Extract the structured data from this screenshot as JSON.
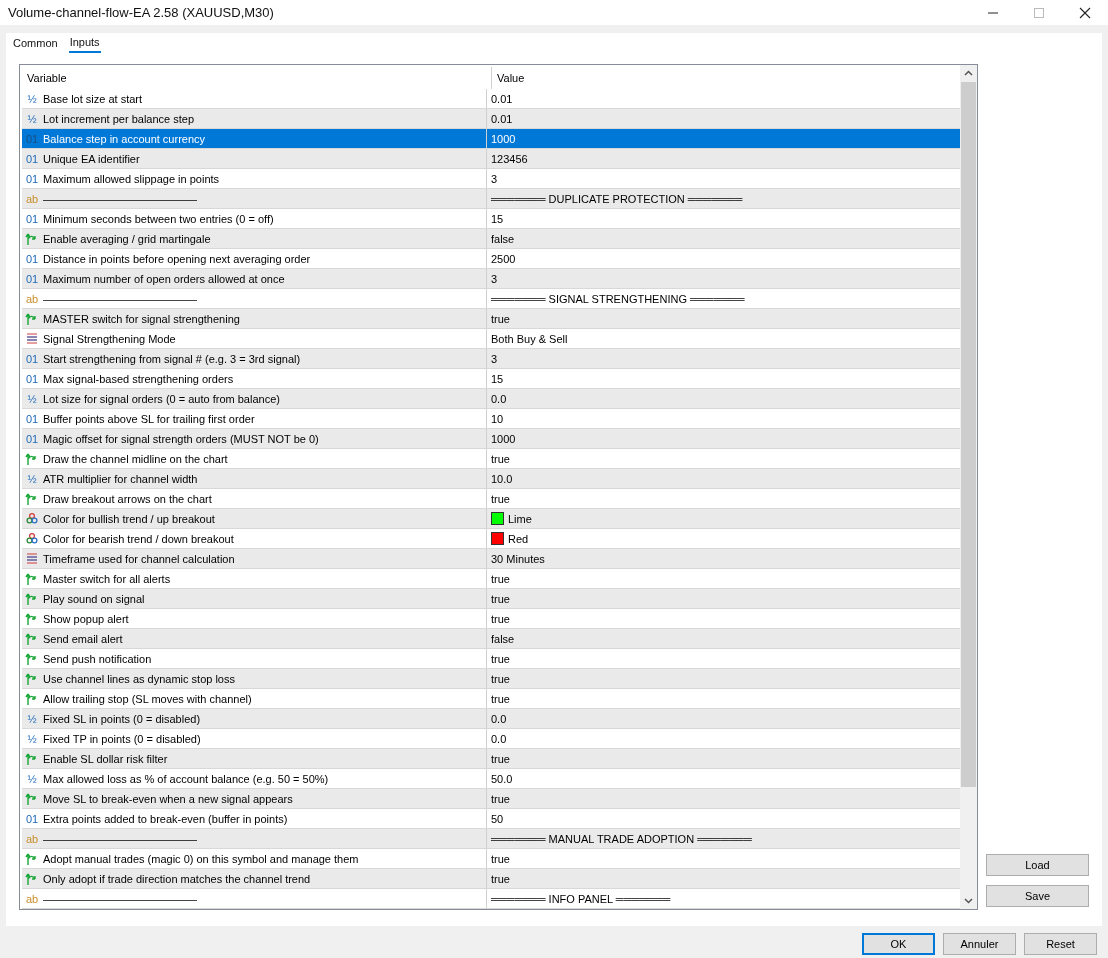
{
  "window": {
    "title": "Volume-channel-flow-EA 2.58 (XAUUSD,M30)"
  },
  "tabs": [
    {
      "label": "Common",
      "selected": false
    },
    {
      "label": "Inputs",
      "selected": true
    }
  ],
  "table": {
    "columns": [
      "Variable",
      "Value"
    ],
    "rows": [
      {
        "kind": "double",
        "icon": "½",
        "variable": "Base lot size at start",
        "value": "0.01",
        "selected": false
      },
      {
        "kind": "double",
        "icon": "½",
        "variable": "Lot increment per balance step",
        "value": "0.01",
        "selected": false
      },
      {
        "kind": "int",
        "icon": "01",
        "variable": "Balance step in account currency",
        "value": "1000",
        "selected": true
      },
      {
        "kind": "int",
        "icon": "01",
        "variable": "Unique EA identifier",
        "value": "123456",
        "selected": false
      },
      {
        "kind": "int",
        "icon": "01",
        "variable": "Maximum allowed slippage in points",
        "value": "3",
        "selected": false
      },
      {
        "kind": "string",
        "icon": "ab",
        "variable": "——————————————",
        "value": "═══════ DUPLICATE PROTECTION ═══════",
        "selected": false
      },
      {
        "kind": "int",
        "icon": "01",
        "variable": "Minimum seconds between two entries (0 = off)",
        "value": "15",
        "selected": false
      },
      {
        "kind": "bool",
        "variable": "Enable averaging / grid martingale",
        "value": "false",
        "selected": false
      },
      {
        "kind": "int",
        "icon": "01",
        "variable": "Distance in points before opening next averaging order",
        "value": "2500",
        "selected": false
      },
      {
        "kind": "int",
        "icon": "01",
        "variable": "Maximum number of open orders allowed at once",
        "value": "3",
        "selected": false
      },
      {
        "kind": "string",
        "icon": "ab",
        "variable": "——————————————",
        "value": "═══════ SIGNAL STRENGTHENING ═══════",
        "selected": false
      },
      {
        "kind": "bool",
        "variable": "MASTER switch for signal strengthening",
        "value": "true",
        "selected": false
      },
      {
        "kind": "enum",
        "variable": "Signal Strengthening Mode",
        "value": "Both Buy & Sell",
        "selected": false
      },
      {
        "kind": "int",
        "icon": "01",
        "variable": "Start strengthening from signal # (e.g. 3 = 3rd signal)",
        "value": "3",
        "selected": false
      },
      {
        "kind": "int",
        "icon": "01",
        "variable": "Max signal-based strengthening orders",
        "value": "15",
        "selected": false
      },
      {
        "kind": "double",
        "icon": "½",
        "variable": "Lot size for signal orders (0 = auto from balance)",
        "value": "0.0",
        "selected": false
      },
      {
        "kind": "int",
        "icon": "01",
        "variable": "Buffer points above SL for trailing first order",
        "value": "10",
        "selected": false
      },
      {
        "kind": "int",
        "icon": "01",
        "variable": "Magic offset for signal strength orders (MUST NOT be 0)",
        "value": "1000",
        "selected": false
      },
      {
        "kind": "bool",
        "variable": "Draw the channel midline on the chart",
        "value": "true",
        "selected": false
      },
      {
        "kind": "double",
        "icon": "½",
        "variable": "ATR multiplier for channel width",
        "value": "10.0",
        "selected": false
      },
      {
        "kind": "bool",
        "variable": "Draw breakout arrows on the chart",
        "value": "true",
        "selected": false
      },
      {
        "kind": "color",
        "variable": "Color for bullish trend / up breakout",
        "value": "Lime",
        "color": "#00ff00",
        "selected": false
      },
      {
        "kind": "color",
        "variable": "Color for bearish trend / down breakout",
        "value": "Red",
        "color": "#ff0000",
        "selected": false
      },
      {
        "kind": "enum",
        "variable": "Timeframe used for channel calculation",
        "value": "30 Minutes",
        "selected": false
      },
      {
        "kind": "bool",
        "variable": "Master switch for all alerts",
        "value": "true",
        "selected": false
      },
      {
        "kind": "bool",
        "variable": "Play sound on signal",
        "value": "true",
        "selected": false
      },
      {
        "kind": "bool",
        "variable": "Show popup alert",
        "value": "true",
        "selected": false
      },
      {
        "kind": "bool",
        "variable": "Send email alert",
        "value": "false",
        "selected": false
      },
      {
        "kind": "bool",
        "variable": "Send push notification",
        "value": "true",
        "selected": false
      },
      {
        "kind": "bool",
        "variable": "Use channel lines as dynamic stop loss",
        "value": "true",
        "selected": false
      },
      {
        "kind": "bool",
        "variable": "Allow trailing stop (SL moves with channel)",
        "value": "true",
        "selected": false
      },
      {
        "kind": "double",
        "icon": "½",
        "variable": "Fixed SL in points (0 = disabled)",
        "value": "0.0",
        "selected": false
      },
      {
        "kind": "double",
        "icon": "½",
        "variable": "Fixed TP in points (0 = disabled)",
        "value": "0.0",
        "selected": false
      },
      {
        "kind": "bool",
        "variable": "Enable SL dollar risk filter",
        "value": "true",
        "selected": false
      },
      {
        "kind": "double",
        "icon": "½",
        "variable": "Max allowed loss as % of account balance (e.g. 50 = 50%)",
        "value": "50.0",
        "selected": false
      },
      {
        "kind": "bool",
        "variable": "Move SL to break-even when a new signal appears",
        "value": "true",
        "selected": false
      },
      {
        "kind": "int",
        "icon": "01",
        "variable": "Extra points added to break-even (buffer in points)",
        "value": "50",
        "selected": false
      },
      {
        "kind": "string",
        "icon": "ab",
        "variable": "——————————————",
        "value": "═══════ MANUAL TRADE ADOPTION ═══════",
        "selected": false
      },
      {
        "kind": "bool",
        "variable": "Adopt manual trades (magic 0) on this symbol and manage them",
        "value": "true",
        "selected": false
      },
      {
        "kind": "bool",
        "variable": "Only adopt if trade direction matches the channel trend",
        "value": "true",
        "selected": false
      },
      {
        "kind": "string",
        "icon": "ab",
        "variable": "——————————————",
        "value": "═══════ INFO PANEL ═══════",
        "selected": false
      }
    ]
  },
  "side_buttons": [
    "Load",
    "Save"
  ],
  "buttons": [
    {
      "label": "OK",
      "selected": true
    },
    {
      "label": "Annuler",
      "selected": false
    },
    {
      "label": "Reset",
      "selected": false
    }
  ]
}
